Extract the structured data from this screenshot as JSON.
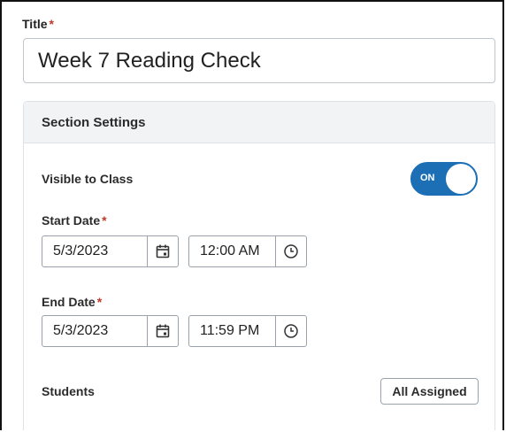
{
  "title_field": {
    "label": "Title",
    "required_mark": "*",
    "value": "Week 7 Reading Check"
  },
  "section": {
    "header": "Section Settings",
    "visible": {
      "label": "Visible to Class",
      "toggle_text": "ON",
      "state": true
    },
    "start": {
      "label": "Start Date",
      "required_mark": "*",
      "date": "5/3/2023",
      "time": "12:00 AM"
    },
    "end": {
      "label": "End Date",
      "required_mark": "*",
      "date": "5/3/2023",
      "time": "11:59 PM"
    },
    "students": {
      "label": "Students",
      "button": "All Assigned"
    }
  },
  "colors": {
    "accent": "#1c6fb5",
    "required": "#c0392b",
    "header_bg": "#f1f3f4"
  }
}
